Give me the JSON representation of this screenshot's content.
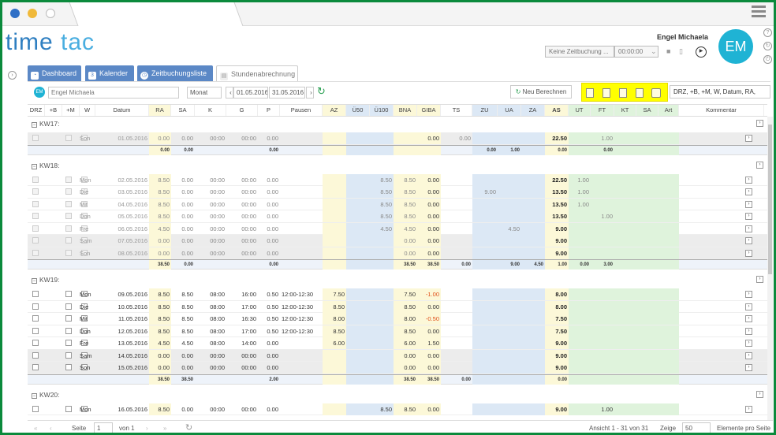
{
  "window": {
    "dots": [
      "#2f6fc6",
      "#f0b93a",
      "#ffffff"
    ]
  },
  "brand": {
    "logo_part1": "time",
    "logo_part2": "tac"
  },
  "user": {
    "name": "Engel Michaela",
    "initials": "EM"
  },
  "booking": {
    "select_label": "Keine Zeitbuchung ...",
    "time": "00:00:00"
  },
  "nav": {
    "tabs": [
      "Dashboard",
      "Kalender",
      "Zeitbuchungsliste",
      "Stundenabrechnung"
    ]
  },
  "toolbar": {
    "employee_initials": "EM",
    "employee": "Engel Michaela",
    "period": "Monat",
    "date_from": "01.05.2016",
    "date_to": "31.05.2016",
    "recalc": "Neu Berechnen",
    "columns_select": "DRZ, +B, +M, W, Datum, RA,"
  },
  "headers": [
    "DRZ",
    "+B",
    "+M",
    "W",
    "Datum",
    "RA",
    "SA",
    "K",
    "G",
    "P",
    "Pausen",
    "AZ",
    "Ü50",
    "Ü100",
    "BNA",
    "GIBA",
    "TS",
    "ZU",
    "UA",
    "ZA",
    "AS",
    "UT",
    "FT",
    "KT",
    "SA",
    "Art",
    "Kommentar"
  ],
  "weeks": [
    {
      "label": "KW17:",
      "rows": [
        [
          "Son",
          "01.05.2016",
          "0.00",
          "0.00",
          "00:00",
          "00:00",
          "0.00",
          "",
          "",
          "",
          "",
          "",
          "0.00",
          "0.00",
          "",
          "",
          "",
          "22.50",
          "",
          "1.00",
          "",
          "",
          ""
        ]
      ],
      "sum": [
        "0.00",
        "0.00",
        "0.00",
        "0.00",
        "0.00",
        "",
        "",
        "0.00",
        "1.00"
      ]
    },
    {
      "label": "KW18:",
      "rows": [
        [
          "Mon",
          "02.05.2016",
          "8.50",
          "0.00",
          "00:00",
          "00:00",
          "0.00",
          "",
          "",
          "",
          "8.50",
          "8.50",
          "0.00",
          "",
          "",
          "",
          "",
          "22.50",
          "1.00",
          "",
          "",
          "",
          ""
        ],
        [
          "Die",
          "03.05.2016",
          "8.50",
          "0.00",
          "00:00",
          "00:00",
          "0.00",
          "",
          "",
          "",
          "8.50",
          "8.50",
          "0.00",
          "",
          "9.00",
          "",
          "",
          "13.50",
          "1.00",
          "",
          "",
          "",
          ""
        ],
        [
          "Mit",
          "04.05.2016",
          "8.50",
          "0.00",
          "00:00",
          "00:00",
          "0.00",
          "",
          "",
          "",
          "8.50",
          "8.50",
          "0.00",
          "",
          "",
          "",
          "",
          "13.50",
          "1.00",
          "",
          "",
          "",
          ""
        ],
        [
          "Don",
          "05.05.2016",
          "8.50",
          "0.00",
          "00:00",
          "00:00",
          "0.00",
          "",
          "",
          "",
          "8.50",
          "8.50",
          "0.00",
          "",
          "",
          "",
          "",
          "13.50",
          "",
          "1.00",
          "",
          "",
          ""
        ],
        [
          "Fre",
          "06.05.2016",
          "4.50",
          "0.00",
          "00:00",
          "00:00",
          "0.00",
          "",
          "",
          "",
          "4.50",
          "4.50",
          "0.00",
          "",
          "",
          "4.50",
          "",
          "9.00",
          "",
          "",
          "",
          "",
          ""
        ],
        [
          "Sam",
          "07.05.2016",
          "0.00",
          "0.00",
          "00:00",
          "00:00",
          "0.00",
          "",
          "",
          "",
          "",
          "0.00",
          "0.00",
          "",
          "",
          "",
          "",
          "9.00",
          "",
          "",
          "",
          "",
          ""
        ],
        [
          "Son",
          "08.05.2016",
          "0.00",
          "0.00",
          "00:00",
          "00:00",
          "0.00",
          "",
          "",
          "",
          "",
          "0.00",
          "0.00",
          "",
          "",
          "",
          "",
          "9.00",
          "",
          "",
          "",
          "",
          ""
        ]
      ],
      "sum": [
        "38.50",
        "0.00",
        "0.00",
        "38.50",
        "38.50",
        "0.00",
        "9.00",
        "4.50",
        "0.00",
        "3.00",
        "1.00"
      ]
    },
    {
      "label": "KW19:",
      "rows": [
        [
          "Mon",
          "09.05.2016",
          "8.50",
          "8.50",
          "08:00",
          "16:00",
          "0.50",
          "12:00-12:30",
          "7.50",
          "",
          "",
          "7.50",
          "-1.00",
          "",
          "",
          "",
          "",
          "8.00",
          "",
          "",
          "",
          "",
          ""
        ],
        [
          "Die",
          "10.05.2016",
          "8.50",
          "8.50",
          "08:00",
          "17:00",
          "0.50",
          "12:00-12:30",
          "8.50",
          "",
          "",
          "8.50",
          "0.00",
          "",
          "",
          "",
          "",
          "8.00",
          "",
          "",
          "",
          "",
          ""
        ],
        [
          "Mit",
          "11.05.2016",
          "8.50",
          "8.50",
          "08:00",
          "16:30",
          "0.50",
          "12:00-12:30",
          "8.00",
          "",
          "",
          "8.00",
          "-0.50",
          "",
          "",
          "",
          "",
          "7.50",
          "",
          "",
          "",
          "",
          ""
        ],
        [
          "Don",
          "12.05.2016",
          "8.50",
          "8.50",
          "08:00",
          "17:00",
          "0.50",
          "12:00-12:30",
          "8.50",
          "",
          "",
          "8.50",
          "0.00",
          "",
          "",
          "",
          "",
          "7.50",
          "",
          "",
          "",
          "",
          ""
        ],
        [
          "Fre",
          "13.05.2016",
          "4.50",
          "4.50",
          "08:00",
          "14:00",
          "0.00",
          "",
          "6.00",
          "",
          "",
          "6.00",
          "1.50",
          "",
          "",
          "",
          "",
          "9.00",
          "",
          "",
          "",
          "",
          ""
        ],
        [
          "Sam",
          "14.05.2016",
          "0.00",
          "0.00",
          "00:00",
          "00:00",
          "0.00",
          "",
          "",
          "",
          "",
          "0.00",
          "0.00",
          "",
          "",
          "",
          "",
          "9.00",
          "",
          "",
          "",
          "",
          ""
        ],
        [
          "Son",
          "15.05.2016",
          "0.00",
          "0.00",
          "00:00",
          "00:00",
          "0.00",
          "",
          "",
          "",
          "",
          "0.00",
          "0.00",
          "",
          "",
          "",
          "",
          "9.00",
          "",
          "",
          "",
          "",
          ""
        ]
      ],
      "sum": [
        "38.50",
        "38.50",
        "2.00",
        "38.50",
        "38.50",
        "0.00",
        "0.00"
      ]
    },
    {
      "label": "KW20:",
      "rows": [
        [
          "Mon",
          "16.05.2016",
          "8.50",
          "0.00",
          "00:00",
          "00:00",
          "0.00",
          "",
          "",
          "",
          "8.50",
          "8.50",
          "0.00",
          "",
          "",
          "",
          "",
          "9.00",
          "",
          "1.00",
          "",
          "",
          ""
        ]
      ],
      "sum": []
    }
  ],
  "footer": {
    "page_label": "Seite",
    "page": "1",
    "of": "von 1",
    "view": "Ansicht 1 - 31 von 31",
    "show": "Zeige",
    "per_page": "50",
    "per_page_label": "Elemente pro Seite"
  }
}
